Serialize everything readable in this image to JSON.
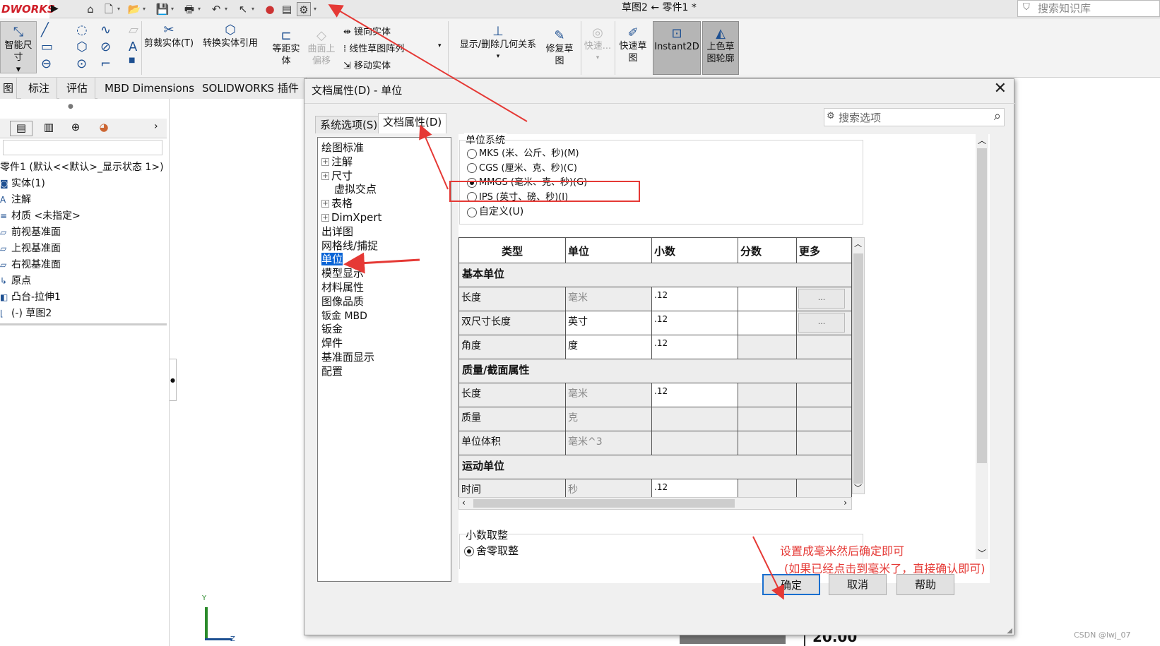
{
  "titlebar": {
    "logo": "DWORKS",
    "doc_title": "草图2 ← 零件1 *",
    "kb_search_placeholder": "搜索知识库"
  },
  "ribbon": {
    "smart_dim": "智能尺寸",
    "trim": "剪裁实体(T)",
    "convert": "转换实体引用",
    "offset": [
      "等距实",
      "体"
    ],
    "offset_surface": [
      "曲面上",
      "偏移"
    ],
    "mirror": "镜向实体",
    "linear_pattern": "线性草图阵列",
    "move": "移动实体",
    "display_relations": "显示/删除几何关系",
    "repair": [
      "修复草",
      "图"
    ],
    "quick_snap": "快速...",
    "quick_sketch": [
      "快速草",
      "图"
    ],
    "instant2d": "Instant2D",
    "shaded_contour": [
      "上色草",
      "图轮廓"
    ]
  },
  "tabs": [
    "图",
    "标注",
    "评估",
    "MBD Dimensions",
    "SOLIDWORKS 插件"
  ],
  "feature_tree": {
    "root": "零件1 (默认<<默认>_显示状态 1>)",
    "items": [
      "实体(1)",
      "注解",
      "材质 <未指定>",
      "前视基准面",
      "上视基准面",
      "右视基准面",
      "原点",
      "凸台-拉伸1",
      "(-) 草图2"
    ]
  },
  "dialog": {
    "title": "文档属性(D) - 单位",
    "tab_system": "系统选项(S)",
    "tab_document": "文档属性(D)",
    "search_placeholder": "搜索选项",
    "nav": [
      {
        "label": "绘图标准",
        "indent": 0,
        "expandable": false
      },
      {
        "label": "注解",
        "indent": 0,
        "expandable": true
      },
      {
        "label": "尺寸",
        "indent": 0,
        "expandable": true
      },
      {
        "label": "虚拟交点",
        "indent": 1,
        "expandable": false
      },
      {
        "label": "表格",
        "indent": 0,
        "expandable": true
      },
      {
        "label": "DimXpert",
        "indent": 0,
        "expandable": true
      },
      {
        "label": "出详图",
        "indent": 0,
        "expandable": false
      },
      {
        "label": "网格线/捕捉",
        "indent": 0,
        "expandable": false
      },
      {
        "label": "单位",
        "indent": 0,
        "expandable": false,
        "selected": true
      },
      {
        "label": "模型显示",
        "indent": 0,
        "expandable": false
      },
      {
        "label": "材料属性",
        "indent": 0,
        "expandable": false
      },
      {
        "label": "图像品质",
        "indent": 0,
        "expandable": false
      },
      {
        "label": "钣金 MBD",
        "indent": 0,
        "expandable": false
      },
      {
        "label": "钣金",
        "indent": 0,
        "expandable": false
      },
      {
        "label": "焊件",
        "indent": 0,
        "expandable": false
      },
      {
        "label": "基准面显示",
        "indent": 0,
        "expandable": false
      },
      {
        "label": "配置",
        "indent": 0,
        "expandable": false
      }
    ],
    "unit_system_label": "单位系统",
    "unit_options": [
      {
        "label": "MKS (米、公斤、秒)(M)",
        "checked": false
      },
      {
        "label": "CGS (厘米、克、秒)(C)",
        "checked": false
      },
      {
        "label": "MMGS (毫米、克、秒)(G)",
        "checked": true
      },
      {
        "label": "IPS (英寸、磅、秒)(I)",
        "checked": false
      },
      {
        "label": "自定义(U)",
        "checked": false
      }
    ],
    "table_headers": [
      "类型",
      "单位",
      "小数",
      "分数",
      "更多"
    ],
    "sections": [
      {
        "name": "基本单位",
        "rows": [
          {
            "type": "长度",
            "unit": "毫米",
            "decimal": ".12",
            "unit_grey": true,
            "more": "..."
          },
          {
            "type": "双尺寸长度",
            "unit": "英寸",
            "decimal": ".12",
            "unit_grey": false,
            "more": "..."
          },
          {
            "type": "角度",
            "unit": "度",
            "decimal": ".12",
            "unit_grey": false,
            "more": ""
          }
        ]
      },
      {
        "name": "质量/截面属性",
        "rows": [
          {
            "type": "长度",
            "unit": "毫米",
            "decimal": ".12",
            "unit_grey": true,
            "more": ""
          },
          {
            "type": "质量",
            "unit": "克",
            "decimal": "",
            "unit_grey": true,
            "more": ""
          },
          {
            "type": "单位体积",
            "unit": "毫米^3",
            "decimal": "",
            "unit_grey": true,
            "more": ""
          }
        ]
      },
      {
        "name": "运动单位",
        "rows": [
          {
            "type": "时间",
            "unit": "秒",
            "decimal": ".12",
            "unit_grey": true,
            "more": ""
          }
        ]
      }
    ],
    "rounding_label": "小数取整",
    "rounding_option": "舍零取整",
    "ok": "确定",
    "cancel": "取消",
    "help": "帮助"
  },
  "annotation": {
    "line1": "设置成毫米然后确定即可",
    "line2": "(如果已经点击到毫米了，直接确认即可)"
  },
  "misc": {
    "bottom_value": "20.00",
    "watermark": "CSDN @lwj_07",
    "axis_y": "Y",
    "axis_z": "Z"
  }
}
